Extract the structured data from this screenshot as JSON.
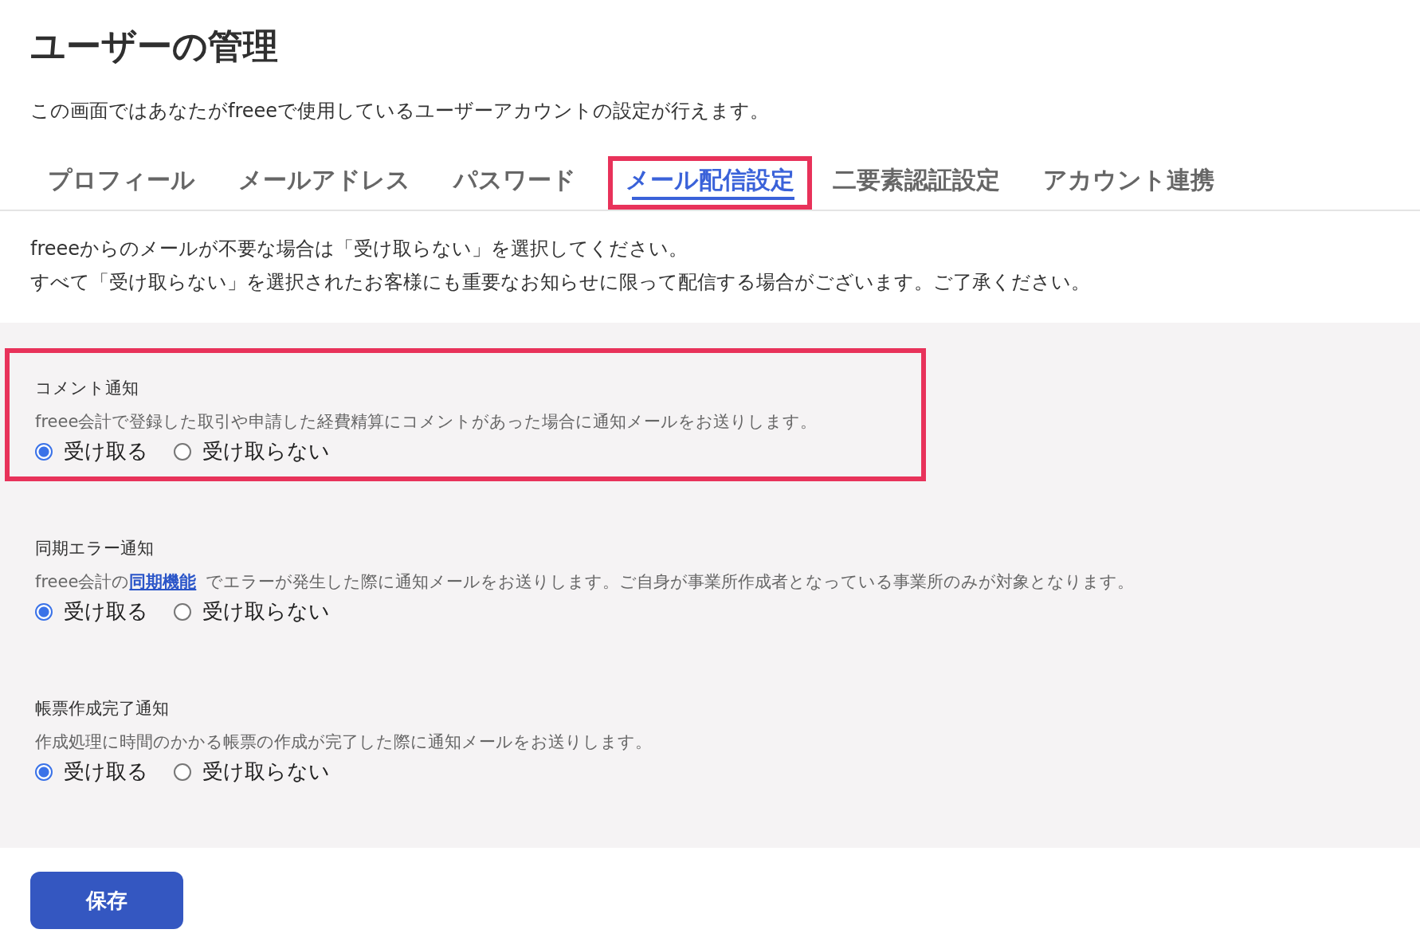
{
  "title": "ユーザーの管理",
  "description": "この画面ではあなたがfreeeで使用しているユーザーアカウントの設定が行えます。",
  "tabs": [
    {
      "label": "プロフィール",
      "selected": false,
      "highlighted": false
    },
    {
      "label": "メールアドレス",
      "selected": false,
      "highlighted": false
    },
    {
      "label": "パスワード",
      "selected": false,
      "highlighted": false
    },
    {
      "label": "メール配信設定",
      "selected": true,
      "highlighted": true
    },
    {
      "label": "二要素認証設定",
      "selected": false,
      "highlighted": false
    },
    {
      "label": "アカウント連携",
      "selected": false,
      "highlighted": false
    }
  ],
  "intro": [
    "freeeからのメールが不要な場合は「受け取らない」を選択してください。",
    "すべて「受け取らない」を選択されたお客様にも重要なお知らせに限って配信する場合がございます。ご了承ください。"
  ],
  "sections": [
    {
      "heading": "コメント通知",
      "highlighted": true,
      "description": "freee会計で登録した取引や申請した経費精算にコメントがあった場合に通知メールをお送りします。",
      "options": [
        {
          "label": "受け取る",
          "selected": true
        },
        {
          "label": "受け取らない",
          "selected": false
        }
      ]
    },
    {
      "heading": "同期エラー通知",
      "highlighted": false,
      "description": "freee会計の",
      "link": "同期機能",
      "description_after": "でエラーが発生した際に通知メールをお送りします。ご自身が事業所作成者となっている事業所のみが対象となります。",
      "options": [
        {
          "label": "受け取る",
          "selected": true
        },
        {
          "label": "受け取らない",
          "selected": false
        }
      ]
    },
    {
      "heading": "帳票作成完了通知",
      "highlighted": false,
      "description": "作成処理に時間のかかる帳票の作成が完了した際に通知メールをお送りします。",
      "options": [
        {
          "label": "受け取る",
          "selected": true
        },
        {
          "label": "受け取らない",
          "selected": false
        }
      ]
    }
  ],
  "save_button": "保存"
}
